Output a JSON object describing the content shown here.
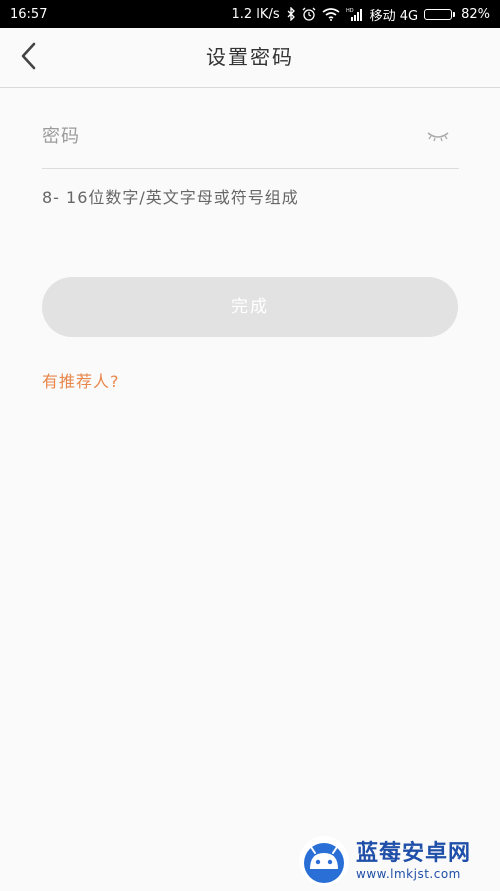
{
  "status_bar": {
    "time": "16:57",
    "network_speed": "1.2 lK/s",
    "carrier": "移动 4G",
    "battery_percent": "82%",
    "battery_level": 0.82,
    "icons": [
      "bluetooth-icon",
      "alarm-icon",
      "wifi-icon",
      "hd-signal-icon",
      "battery-icon"
    ]
  },
  "header": {
    "title": "设置密码",
    "back_icon": "chevron-left-icon"
  },
  "password": {
    "placeholder": "密码",
    "value": "",
    "toggle_icon": "eye-closed-icon"
  },
  "hint": "8- 16位数字/英文字母或符号组成",
  "done_button": "完成",
  "referrer_link": "有推荐人?",
  "colors": {
    "accent": "#e8874b",
    "button_disabled": "#e2e2e2",
    "background": "#fafafa"
  },
  "watermark": {
    "title": "蓝莓安卓网",
    "url": "www.lmkjst.com"
  }
}
